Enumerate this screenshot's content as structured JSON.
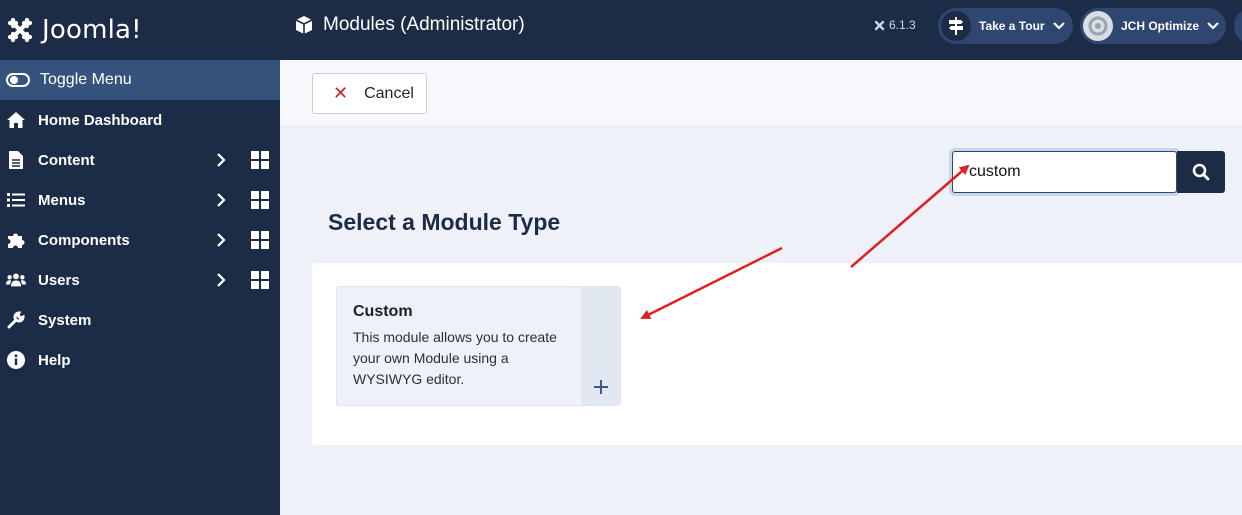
{
  "brand": {
    "name": "Joomla!"
  },
  "sidebar": {
    "toggle_label": "Toggle Menu",
    "items": [
      {
        "label": "Home Dashboard",
        "icon": "home-icon"
      },
      {
        "label": "Content",
        "icon": "file-icon"
      },
      {
        "label": "Menus",
        "icon": "list-icon"
      },
      {
        "label": "Components",
        "icon": "puzzle-icon"
      },
      {
        "label": "Users",
        "icon": "users-icon"
      },
      {
        "label": "System",
        "icon": "wrench-icon"
      },
      {
        "label": "Help",
        "icon": "info-icon"
      }
    ]
  },
  "header": {
    "title": "Modules (Administrator)",
    "version": "6.1.3",
    "take_tour_label": "Take a Tour",
    "jch_label": "JCH Optimize"
  },
  "toolbar": {
    "cancel_label": "Cancel"
  },
  "search": {
    "value": "custom"
  },
  "main": {
    "section_title": "Select a Module Type",
    "modules": [
      {
        "title": "Custom",
        "description": "This module allows you to create your own Module using a WYSIWYG editor."
      }
    ]
  },
  "colors": {
    "sidebar_bg": "#1c2b46",
    "toggle_bg": "#36537e",
    "annotation_arrow": "#e02020",
    "cancel_icon": "#c52827"
  }
}
